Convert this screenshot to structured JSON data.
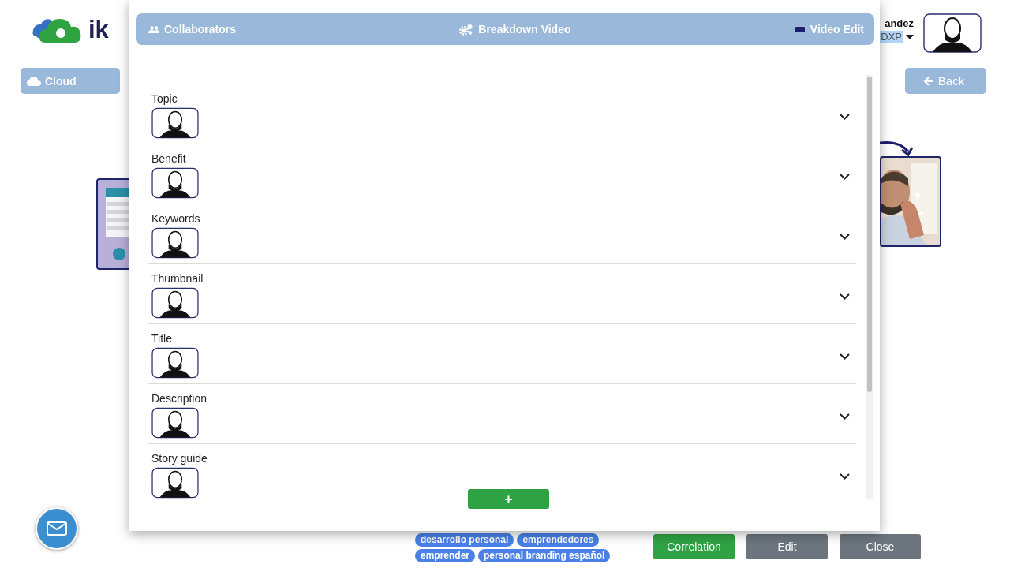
{
  "logo": {
    "text": "ik"
  },
  "user": {
    "name": "andez",
    "role": "DXP",
    "role_highlighted": true
  },
  "cloud_button": {
    "label": "Cloud"
  },
  "back_button": {
    "label": "Back"
  },
  "modal": {
    "tabs": [
      {
        "label": "Collaborators",
        "kind": "people"
      },
      {
        "label": "Breakdown Video",
        "kind": "gears"
      },
      {
        "label": "Video Edit",
        "kind": "screen"
      }
    ],
    "sections": [
      {
        "label": "Topic",
        "expanded": false
      },
      {
        "label": "Benefit",
        "expanded": false
      },
      {
        "label": "Keywords",
        "expanded": false
      },
      {
        "label": "Thumbnail",
        "expanded": false
      },
      {
        "label": "Title",
        "expanded": false
      },
      {
        "label": "Description",
        "expanded": false
      },
      {
        "label": "Story guide",
        "expanded": false
      }
    ],
    "add_button": {
      "label": "+"
    }
  },
  "tags": [
    "desarrollo personal",
    "emprendedores",
    "emprender",
    "personal branding español"
  ],
  "actions": [
    {
      "label": "Correlation",
      "kind": "primary"
    },
    {
      "label": "Edit",
      "kind": "secondary"
    },
    {
      "label": "Close",
      "kind": "secondary"
    }
  ]
}
